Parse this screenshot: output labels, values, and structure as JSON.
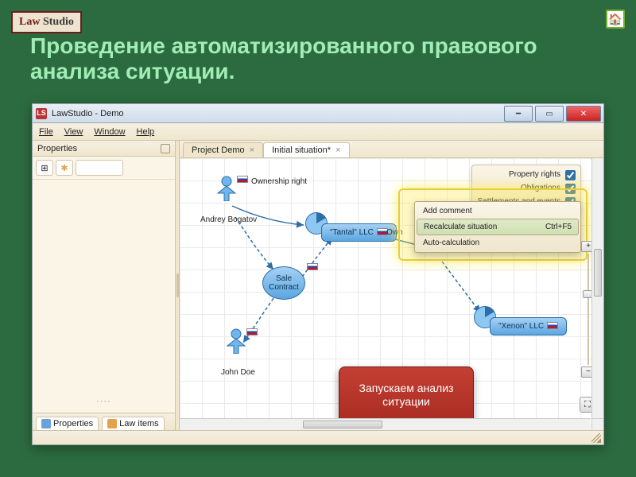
{
  "slide": {
    "logo_l1": "Law",
    "logo_l2": " Studio",
    "title": "Проведение автоматизированного правового анализа ситуации.",
    "callout": "Запускаем анализ ситуации"
  },
  "window": {
    "title": "LawStudio - Demo",
    "menubar": {
      "file": "File",
      "view": "View",
      "window": "Window",
      "help": "Help"
    },
    "left_panel": {
      "title": "Properties",
      "dots": "····",
      "tab1": "Properties",
      "tab2": "Law items"
    },
    "tabs": {
      "project": "Project Demo",
      "initial": "Initial situation*"
    },
    "legend": {
      "rights": "Property rights",
      "obligations": "Obligations",
      "events": "Settlements and events"
    },
    "context_menu": {
      "add_comment": "Add comment",
      "recalc": "Recalculate situation",
      "recalc_key": "Ctrl+F5",
      "auto": "Auto-calculation"
    },
    "diagram": {
      "ownership": "Ownership right",
      "andrey": "Andrey Bogatov",
      "tantal": "\"Tantal\" LLC",
      "own": "Own",
      "sale": "Sale Contract",
      "xenon": "\"Xenon\" LLC",
      "john": "John Doe"
    }
  }
}
